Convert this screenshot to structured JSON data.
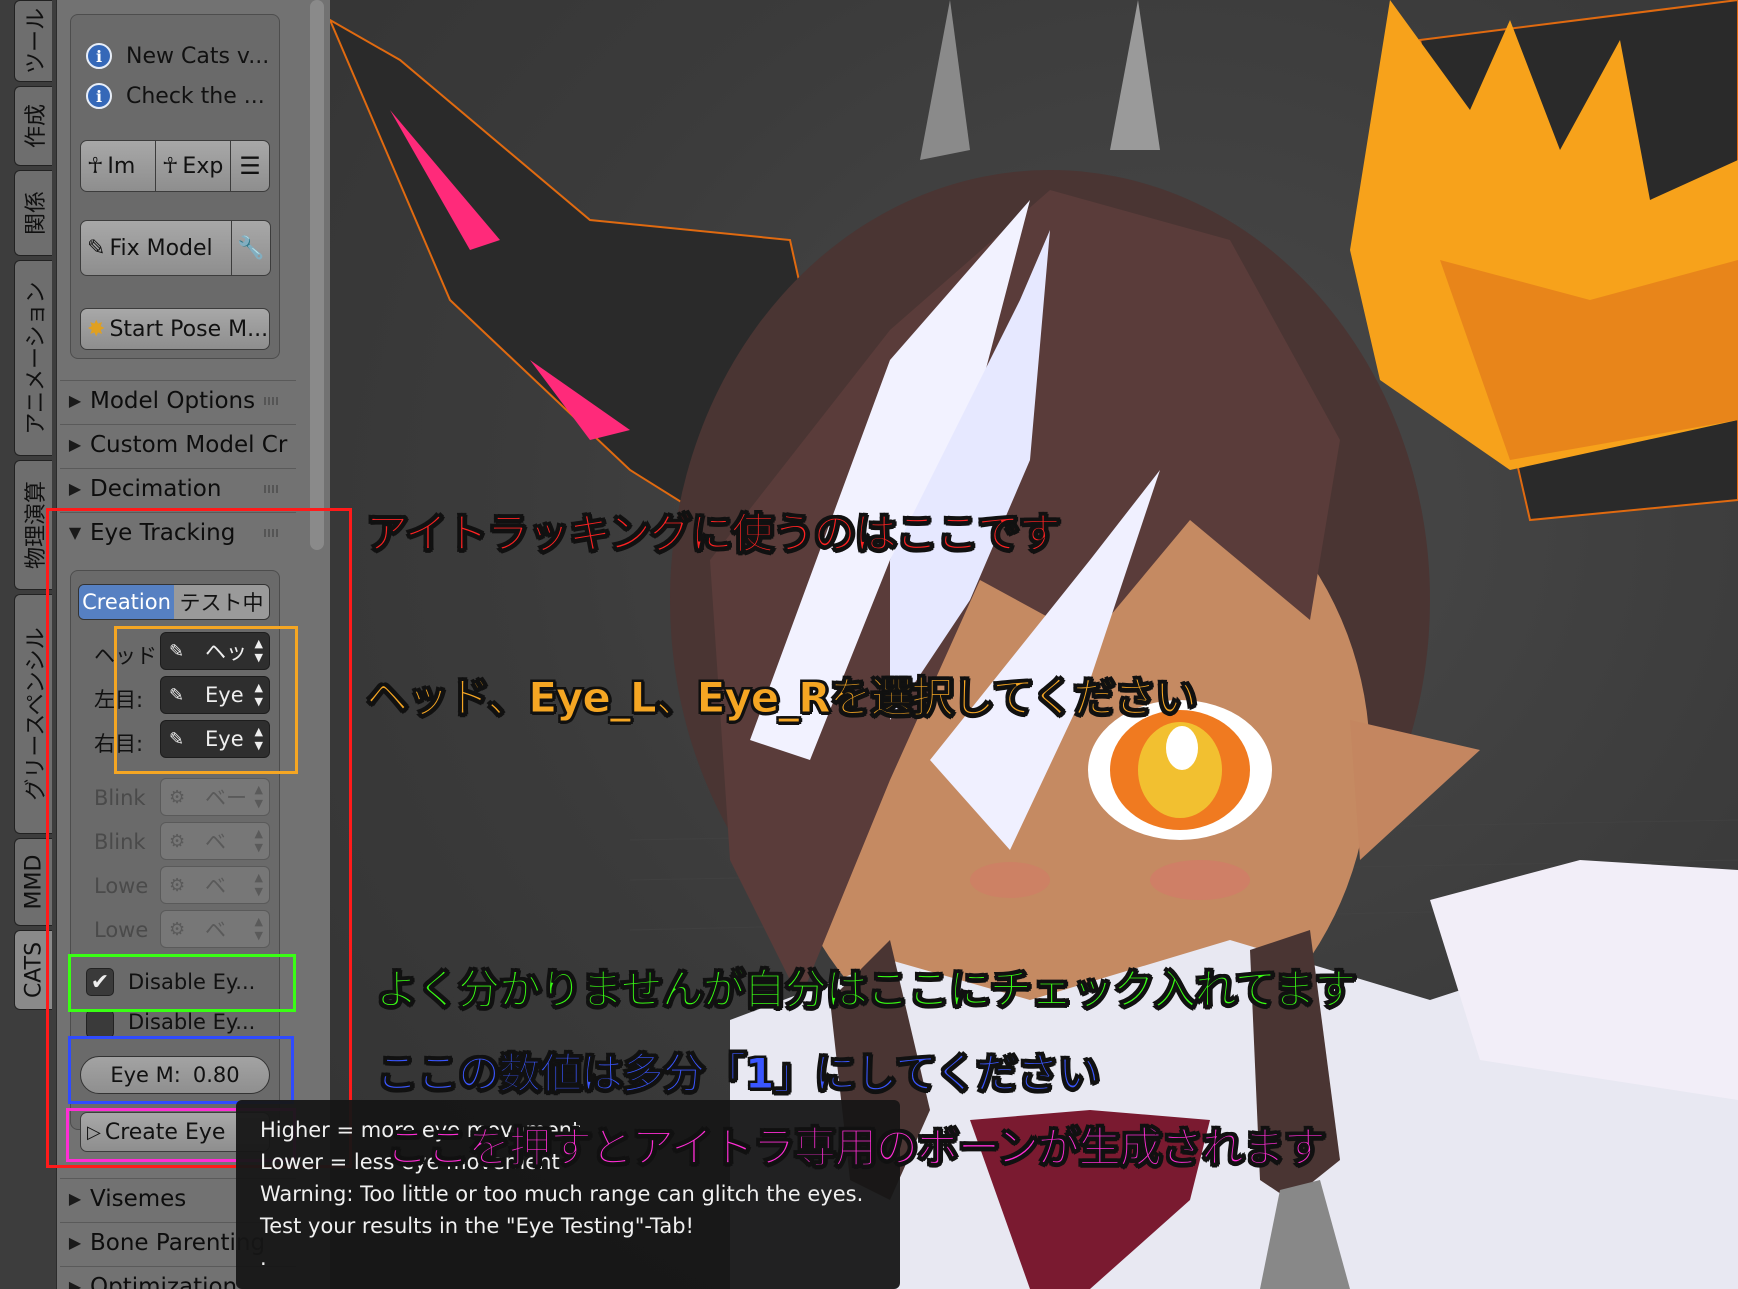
{
  "vertical_tabs": [
    "ツール",
    "作成",
    "関係",
    "アニメーション",
    "物理演算",
    "グリースペンシル",
    "MMD",
    "CATS"
  ],
  "info_lines": [
    "New Cats v...",
    "Check the ..."
  ],
  "toolbar": {
    "import_label": "Im",
    "export_label": "Exp",
    "fix_model_label": "Fix Model",
    "start_pose_label": "Start Pose M..."
  },
  "sections": {
    "model_options": "Model Options",
    "custom_model": "Custom Model Cr",
    "decimation": "Decimation",
    "eye_tracking": "Eye Tracking",
    "visemes": "Visemes",
    "bone_parenting": "Bone Parenting",
    "optimization": "Optimization"
  },
  "eye_tracking": {
    "tab_creation": "Creation",
    "tab_testing": "テスト中",
    "head_label": "ヘッド",
    "head_value": "ヘッ",
    "left_eye_label": "左目:",
    "left_eye_value": "Eye",
    "right_eye_label": "右目:",
    "right_eye_value": "Eye",
    "blink_left_label": "Blink",
    "blink_left_value": "ベー",
    "blink_right_label": "Blink",
    "blink_right_value": "ベ",
    "lower_left_label": "Lowe",
    "lower_left_value": "ベ",
    "lower_right_label": "Lowe",
    "lower_right_value": "ベ",
    "disable_eye_blinking": "Disable Ey...",
    "disable_eye_blinking_checked": true,
    "disable_eye_movement": "Disable Ey...",
    "disable_eye_movement_checked": false,
    "eye_movement_label": "Eye M:",
    "eye_movement_value": "0.80",
    "create_button": "Create Eye"
  },
  "annotations": {
    "red": "アイトラッキングに使うのはここです",
    "orange": "ヘッド、Eye_L、Eye_Rを選択してください",
    "green": "よく分かりませんが自分はここにチェック入れてます",
    "blue": "ここの数値は多分「1」にしてください",
    "magenta": "ここを押すとアイトラ専用のボーンが生成されます"
  },
  "annotation_colors": {
    "red": "#ff1a1a",
    "orange": "#f5a623",
    "green": "#39ff14",
    "blue": "#2f4bff",
    "magenta": "#ff2dd5"
  },
  "tooltip": [
    "Higher = more eye movement",
    "Lower = less eye movement",
    "Warning: Too little or too much range can glitch the eyes.",
    "Test your results in the \"Eye Testing\"-Tab!",
    "."
  ]
}
